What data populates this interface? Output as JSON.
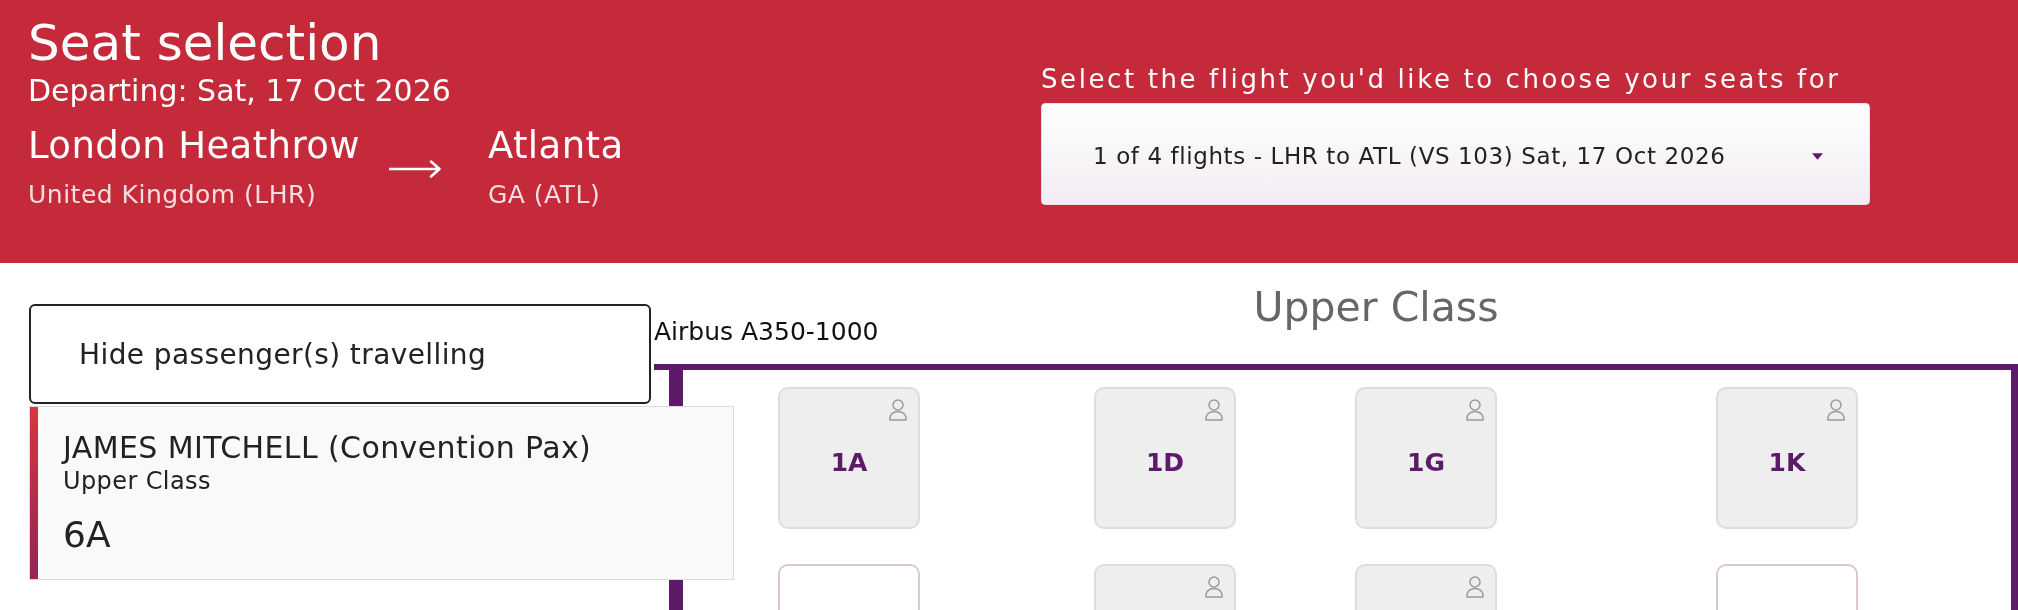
{
  "header": {
    "title": "Seat selection",
    "departure": "Departing: Sat, 17 Oct 2026",
    "origin": {
      "city": "London Heathrow",
      "detail": "United Kingdom (LHR)"
    },
    "destination": {
      "city": "Atlanta",
      "detail": "GA (ATL)"
    },
    "flight_select": {
      "label": "Select the flight you'd like to choose your seats for",
      "value": "1 of 4 flights - LHR to ATL (VS 103) Sat, 17 Oct 2026"
    }
  },
  "passengers": {
    "toggle_label": "Hide passenger(s) travelling",
    "items": [
      {
        "name": "JAMES MITCHELL (Convention Pax)",
        "cabin": "Upper Class",
        "seat": "6A",
        "selected": true
      }
    ]
  },
  "seat_map": {
    "aircraft": "Airbus A350-1000",
    "cabin_title": "Upper Class",
    "rows": [
      {
        "seats": [
          {
            "label": "1A",
            "occupied": true
          },
          {
            "label": "1D",
            "occupied": true
          },
          {
            "label": "1G",
            "occupied": true
          },
          {
            "label": "1K",
            "occupied": true
          }
        ]
      },
      {
        "seats": [
          {
            "occupied": false
          },
          {
            "occupied": true
          },
          {
            "occupied": true
          },
          {
            "occupied": false
          }
        ]
      }
    ]
  }
}
